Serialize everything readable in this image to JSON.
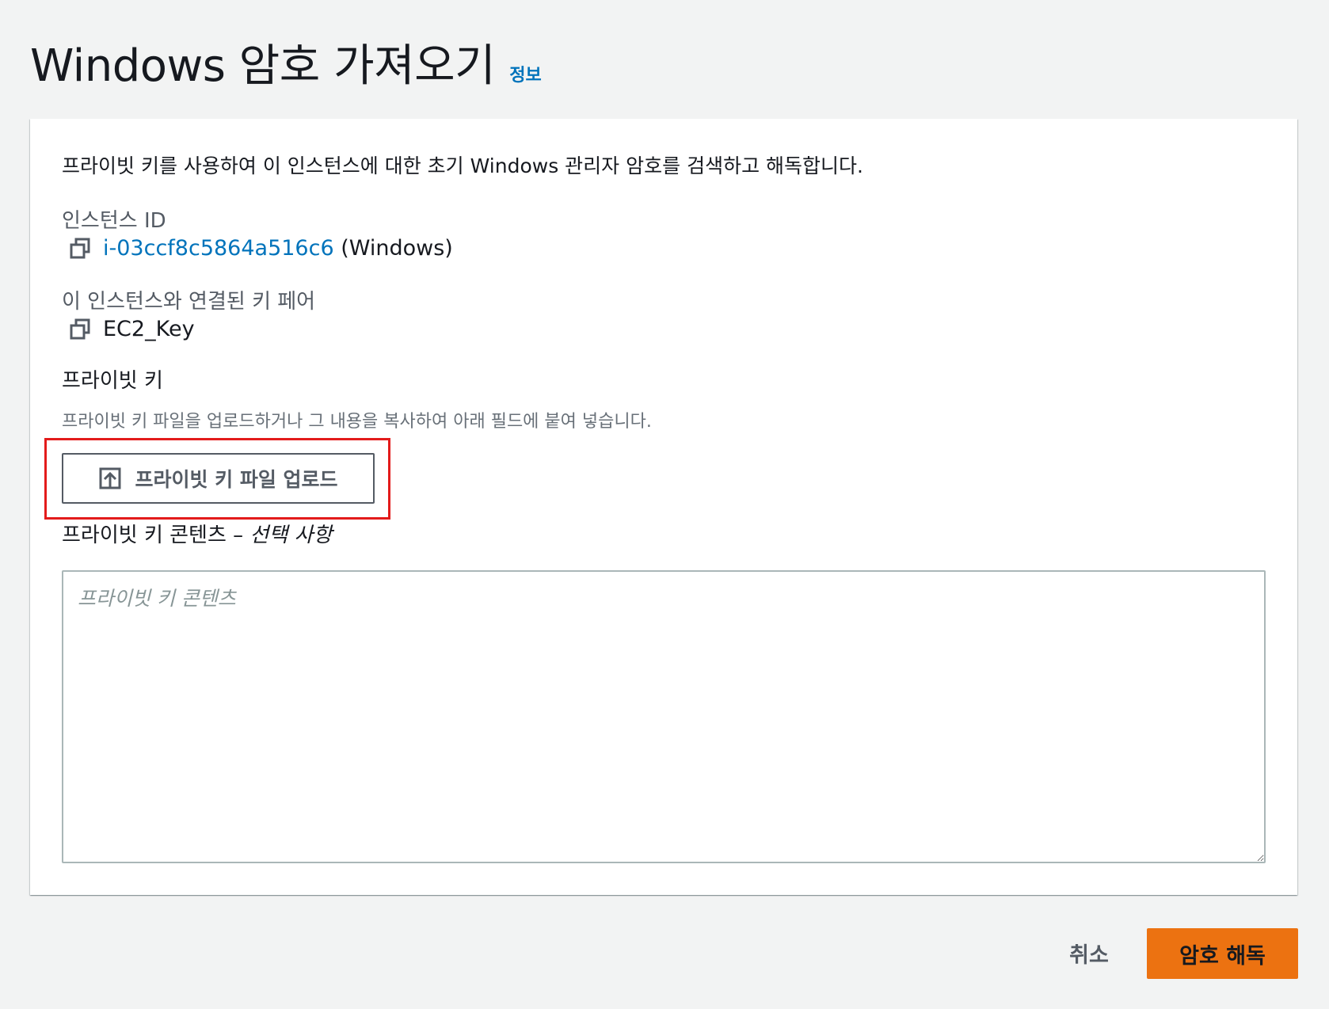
{
  "header": {
    "title": "Windows 암호 가져오기",
    "info_link": "정보"
  },
  "panel": {
    "description": "프라이빗 키를 사용하여 이 인스턴스에 대한 초기 Windows 관리자 암호를 검색하고 해독합니다.",
    "instance_id_label": "인스턴스 ID",
    "instance_id": "i-03ccf8c5864a516c6",
    "instance_platform": "(Windows)",
    "key_pair_label": "이 인스턴스와 연결된 키 페어",
    "key_pair_name": "EC2_Key",
    "private_key_label": "프라이빗 키",
    "private_key_hint": "프라이빗 키 파일을 업로드하거나 그 내용을 복사하여 아래 필드에 붙여 넣습니다.",
    "upload_button_label": "프라이빗 키 파일 업로드",
    "content_label": "프라이빗 키 콘텐츠 –",
    "content_optional": "선택 사항",
    "content_placeholder": "프라이빗 키 콘텐츠",
    "content_value": ""
  },
  "footer": {
    "cancel_label": "취소",
    "decrypt_label": "암호 해독"
  },
  "icons": {
    "copy": "copy-icon",
    "upload": "upload-icon"
  },
  "colors": {
    "link": "#0073bb",
    "primary_button": "#ec7211",
    "highlight": "#e31b1b"
  }
}
